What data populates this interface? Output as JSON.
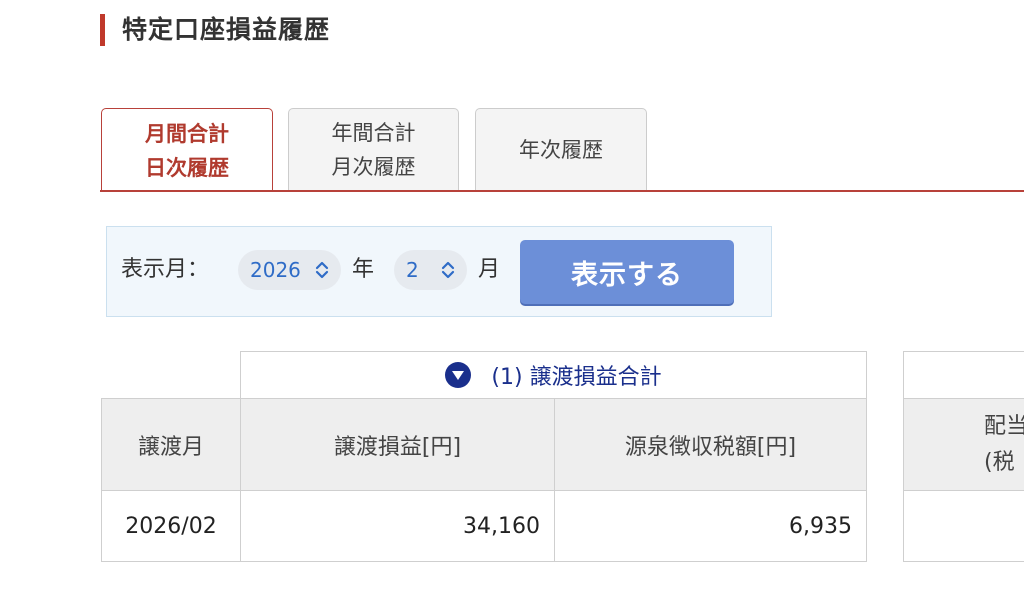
{
  "page": {
    "title": "特定口座損益履歴"
  },
  "tabs": [
    {
      "line1": "月間合計",
      "line2": "日次履歴",
      "active": true
    },
    {
      "line1": "年間合計",
      "line2": "月次履歴",
      "active": false
    },
    {
      "line1": "年次履歴",
      "line2": "",
      "active": false
    }
  ],
  "selector": {
    "label": "表示月：",
    "year_value": "2026",
    "year_unit": "年",
    "month_value": "2",
    "month_unit": "月",
    "submit_label": "表示する"
  },
  "table": {
    "group_header": "(1) 譲渡損益合計",
    "columns": [
      "譲渡月",
      "譲渡損益[円]",
      "源泉徴収税額[円]"
    ],
    "rows": [
      [
        "2026/02",
        "34,160",
        "6,935"
      ]
    ],
    "partial_column": {
      "line1": "配当",
      "line2": "(税"
    }
  },
  "colors": {
    "accent_red": "#b8413a",
    "button_blue": "#6c8fd8",
    "link_navy": "#1a2f8c"
  }
}
